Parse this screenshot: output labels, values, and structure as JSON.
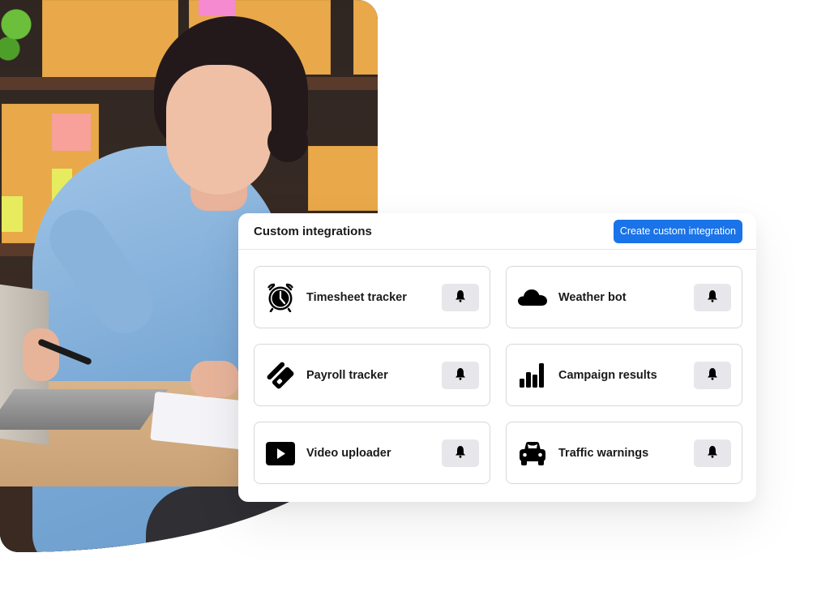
{
  "panel": {
    "title": "Custom integrations",
    "create_button_label": "Create custom integration",
    "accent_color": "#1a73e8"
  },
  "integrations": [
    {
      "label": "Timesheet tracker",
      "icon": "alarm-clock-icon",
      "action_icon": "bell-icon"
    },
    {
      "label": "Weather bot",
      "icon": "cloud-icon",
      "action_icon": "bell-icon"
    },
    {
      "label": "Payroll tracker",
      "icon": "payroll-icon",
      "action_icon": "bell-icon"
    },
    {
      "label": "Campaign results",
      "icon": "bar-chart-icon",
      "action_icon": "bell-icon"
    },
    {
      "label": "Video uploader",
      "icon": "play-video-icon",
      "action_icon": "bell-icon"
    },
    {
      "label": "Traffic warnings",
      "icon": "car-icon",
      "action_icon": "bell-icon"
    }
  ],
  "photo": {
    "subject": "Woman working on laptop in front of shelves of cardboard boxes"
  }
}
